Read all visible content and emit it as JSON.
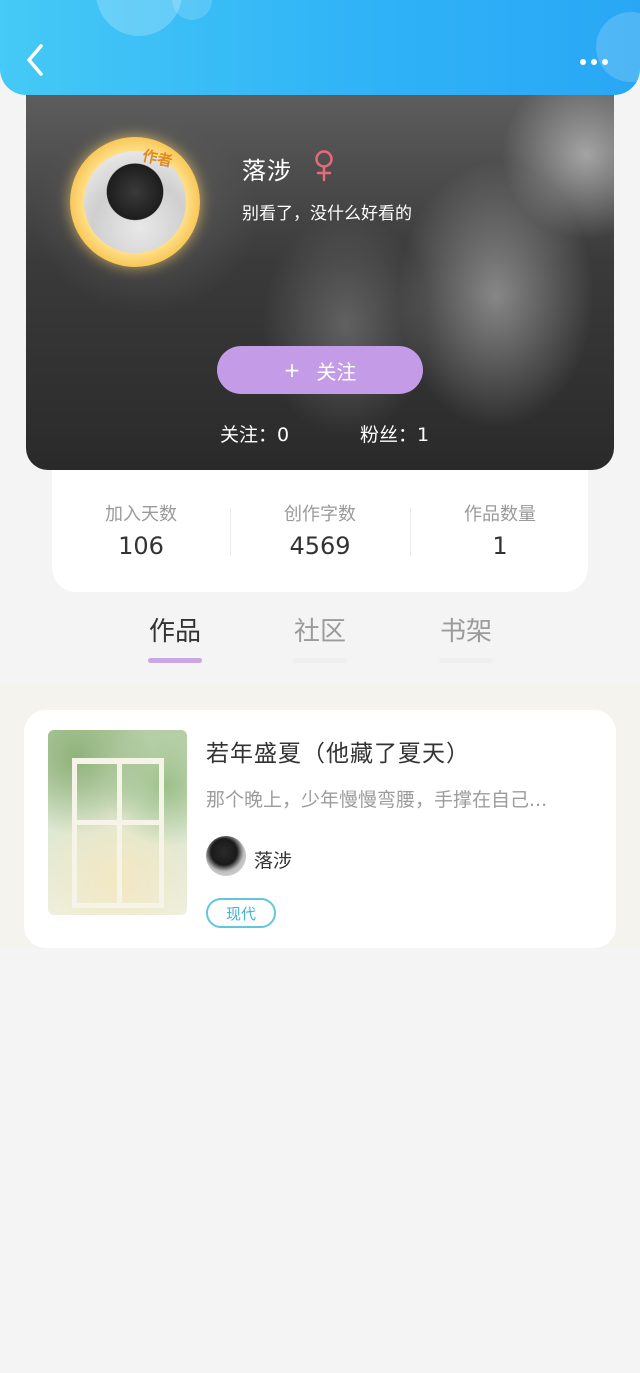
{
  "header": {
    "back_icon": "chevron-left-icon",
    "more_icon": "more-dots-icon"
  },
  "profile": {
    "avatar_badge": "作者",
    "name": "落涉",
    "gender_icon": "female-icon",
    "gender_color": "#e9697c",
    "bio": "别看了，没什么好看的",
    "follow_plus": "+",
    "follow_label": "关注",
    "follow_button_color": "#c49be6",
    "following_text": "关注：0",
    "fans_text": "粉丝：1"
  },
  "stats": [
    {
      "label": "加入天数",
      "value": "106"
    },
    {
      "label": "创作字数",
      "value": "4569"
    },
    {
      "label": "作品数量",
      "value": "1"
    }
  ],
  "tabs": [
    {
      "label": "作品",
      "active": true
    },
    {
      "label": "社区",
      "active": false
    },
    {
      "label": "书架",
      "active": false
    }
  ],
  "works": [
    {
      "title": "若年盛夏（他藏了夏天）",
      "excerpt": "那个晚上，少年慢慢弯腰，手撑在自己...",
      "author": "落涉",
      "tag": "现代",
      "tag_color": "#62c6dd"
    }
  ],
  "colors": {
    "header_blue": "#2fb2f7",
    "tab_active_underline": "#c9a7e4"
  }
}
